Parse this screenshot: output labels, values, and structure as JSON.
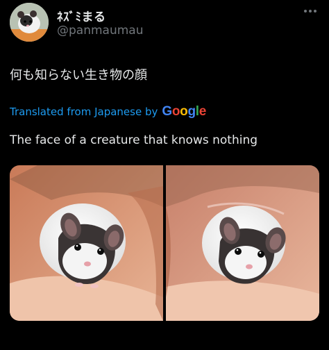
{
  "author": {
    "display_name": "ﾈｽﾞﾐまる",
    "handle": "@panmaumau",
    "avatar_alt": "avatar"
  },
  "tweet": {
    "text": "何も知らない生き物の顔",
    "translated_label": "Translated from Japanese by",
    "google_logo": [
      "G",
      "o",
      "o",
      "g",
      "l",
      "e"
    ],
    "translation": "The face of a creature that knows nothing"
  },
  "media": {
    "photos": [
      "photo-1",
      "photo-2"
    ]
  },
  "icons": {
    "more": "more-horizontal-icon"
  },
  "colors": {
    "background": "#000000",
    "text": "#e7e9ea",
    "secondary": "#71767b",
    "link": "#1d9bf0",
    "google_blue": "#4285F4",
    "google_red": "#EA4335",
    "google_yellow": "#FBBC05",
    "google_green": "#34A853"
  }
}
